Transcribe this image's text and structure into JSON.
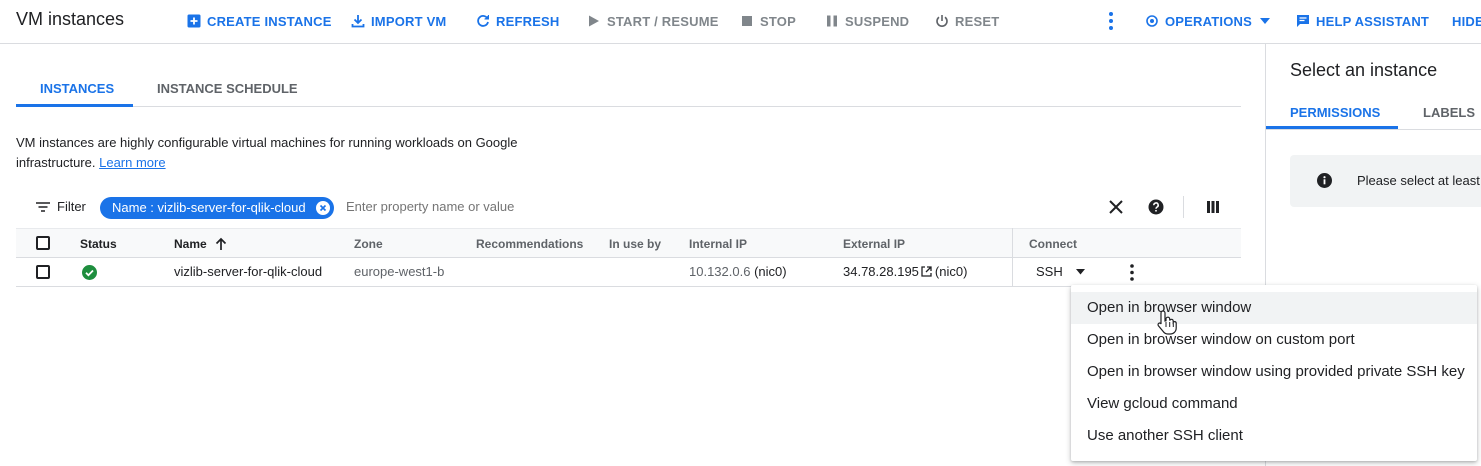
{
  "header": {
    "title": "VM instances",
    "buttons": [
      {
        "label": "CREATE INSTANCE",
        "icon": "add-box-icon"
      },
      {
        "label": "IMPORT VM",
        "icon": "download-icon"
      },
      {
        "label": "REFRESH",
        "icon": "refresh-icon"
      },
      {
        "label": "START / RESUME",
        "icon": "play-icon"
      },
      {
        "label": "STOP",
        "icon": "stop-icon"
      },
      {
        "label": "SUSPEND",
        "icon": "pause-icon"
      },
      {
        "label": "RESET",
        "icon": "power-icon"
      }
    ],
    "operations_label": "OPERATIONS",
    "help_label": "HELP ASSISTANT",
    "hide_label": "HIDE"
  },
  "tabs": [
    {
      "label": "INSTANCES",
      "active": true
    },
    {
      "label": "INSTANCE SCHEDULE",
      "active": false
    }
  ],
  "description": {
    "text": "VM instances are highly configurable virtual machines for running workloads on Google infrastructure.",
    "link": "Learn more"
  },
  "filter": {
    "label": "Filter",
    "chip": "Name : vizlib-server-for-qlik-cloud",
    "placeholder": "Enter property name or value"
  },
  "table": {
    "columns": [
      "Status",
      "Name",
      "Zone",
      "Recommendations",
      "In use by",
      "Internal IP",
      "External IP",
      "Connect"
    ],
    "rows": [
      {
        "status": "running",
        "name": "vizlib-server-for-qlik-cloud",
        "zone": "europe-west1-b",
        "recommendations": "",
        "in_use_by": "",
        "internal_ip": "10.132.0.6",
        "internal_nic": "(nic0)",
        "external_ip": "34.78.28.195",
        "external_nic": "(nic0)",
        "connect": "SSH"
      }
    ]
  },
  "ssh_menu": {
    "items": [
      "Open in browser window",
      "Open in browser window on custom port",
      "Open in browser window using provided private SSH key",
      "View gcloud command",
      "Use another SSH client"
    ]
  },
  "right_panel": {
    "title": "Select an instance",
    "tabs": [
      "PERMISSIONS",
      "LABELS"
    ],
    "info": "Please select at least"
  },
  "colors": {
    "accent": "#1a73e8",
    "success": "#1e8e3e",
    "muted": "#80868b"
  }
}
